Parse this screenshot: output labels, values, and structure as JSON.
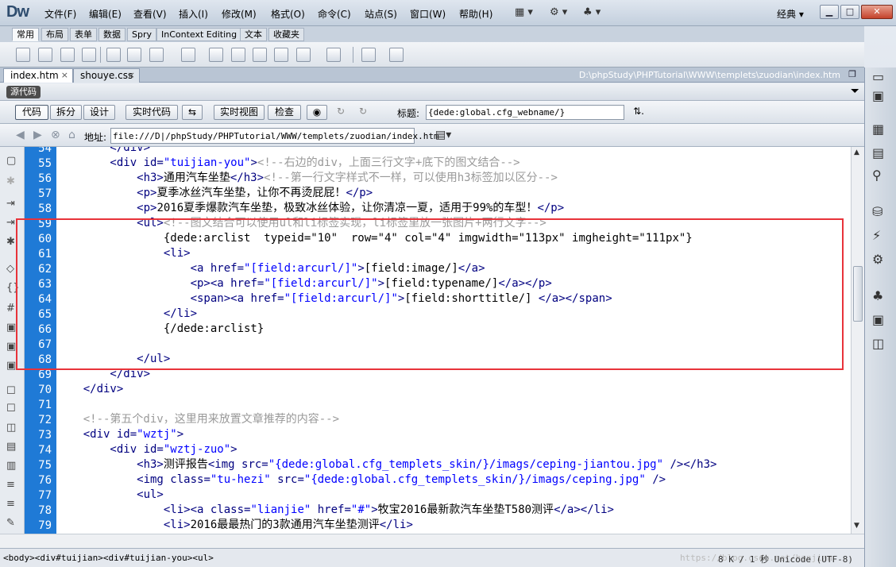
{
  "app": {
    "logo": "Dw",
    "layout": "经典",
    "win_min": "▁",
    "win_max": "□",
    "win_close": "✕"
  },
  "menu": [
    "文件(F)",
    "编辑(E)",
    "查看(V)",
    "插入(I)",
    "修改(M)",
    "格式(O)",
    "命令(C)",
    "站点(S)",
    "窗口(W)",
    "帮助(H)"
  ],
  "insert_tabs": [
    "常用",
    "布局",
    "表单",
    "数据",
    "Spry",
    "InContext Editing",
    "文本",
    "收藏夹"
  ],
  "doc_tabs": [
    {
      "label": "index.htm",
      "close": "×"
    },
    {
      "label": "shouye.css",
      "close": "×"
    }
  ],
  "file_path": "D:\\phpStudy\\PHPTutorial\\WWW\\templets\\zuodian\\index.htm",
  "source_label": "源代码",
  "view_buttons": {
    "code": "代码",
    "split": "拆分",
    "design": "设计",
    "live_code": "实时代码",
    "live_view": "实时视图",
    "inspect": "检查"
  },
  "title_label": "标题:",
  "title_value": "{dede:global.cfg_webname/}",
  "address_label": "地址:",
  "address_value": "file:///D|/phpStudy/PHPTutorial/WWW/templets/zuodian/index.htm",
  "line_numbers": [
    "54",
    "55",
    "56",
    "57",
    "58",
    "59",
    "60",
    "61",
    "62",
    "63",
    "64",
    "65",
    "66",
    "67",
    "68",
    "69",
    "70",
    "71",
    "72",
    "73",
    "74",
    "75",
    "76",
    "77",
    "78",
    "79"
  ],
  "code": {
    "l54": "        </div>",
    "l55_tag": "        <div ",
    "l55_attr": "id=",
    "l55_val": "\"tuijian-you\"",
    "l55_end": ">",
    "l55_cm": "<!--右边的div，上面三行文字+底下的图文结合-->",
    "l56_tag": "            <h3>",
    "l56_tx": "通用汽车坐垫",
    "l56_end": "</h3>",
    "l56_cm": "<!--第一行文字样式不一样，可以使用h3标签加以区分-->",
    "l57_tag": "            <p>",
    "l57_tx": "夏季冰丝汽车坐垫，让你不再烫屁屁！",
    "l57_end": "</p>",
    "l58_tag": "            <p>",
    "l58_tx": "2016夏季爆款汽车坐垫，极致冰丝体验，让你清凉一夏，适用于99%的车型！",
    "l58_end": "</p>",
    "l59_tag": "            <ul>",
    "l59_cm": "<!--图文结合可以使用ul和li标签实现，li标签里放一张图片+两行文字-->",
    "l60": "                {dede:arclist  typeid=\"10\"  row=\"4\" col=\"4\" imgwidth=\"113px\" imgheight=\"111px\"}",
    "l61": "                <li>",
    "l62_tag": "                    <a ",
    "l62_attr": "href=",
    "l62_val": "\"[field:arcurl/]\"",
    "l62_end": ">",
    "l62_tx": "[field:image/]",
    "l62_close": "</a>",
    "l63_tag": "                    <p><a ",
    "l63_attr": "href=",
    "l63_val": "\"[field:arcurl/]\"",
    "l63_end": ">",
    "l63_tx": "[field:typename/]",
    "l63_close": "</a></p>",
    "l64_tag": "                    <span><a ",
    "l64_attr": "href=",
    "l64_val": "\"[field:arcurl/]\"",
    "l64_end": ">",
    "l64_tx": "[field:shorttitle/] ",
    "l64_close": "</a></span>",
    "l65": "                </li>",
    "l66": "                {/dede:arclist}",
    "l67": "",
    "l68": "            </ul>",
    "l69": "        </div>",
    "l70": "    </div>",
    "l71": "",
    "l72": "    <!--第五个div，这里用来放置文章推荐的内容-->",
    "l73_tag": "    <div ",
    "l73_attr": "id=",
    "l73_val": "\"wztj\"",
    "l73_end": ">",
    "l74_tag": "        <div ",
    "l74_attr": "id=",
    "l74_val": "\"wztj-zuo\"",
    "l74_end": ">",
    "l75_tag": "            <h3>",
    "l75_tx": "测评报告",
    "l75_img": "<img ",
    "l75_attr": "src=",
    "l75_val": "\"{dede:global.cfg_templets_skin/}/imags/ceping-jiantou.jpg\"",
    "l75_end": " /></h3>",
    "l76_tag": "            <img ",
    "l76_attr1": "class=",
    "l76_val1": "\"tu-hezi\"",
    "l76_attr2": " src=",
    "l76_val2": "\"{dede:global.cfg_templets_skin/}/imags/ceping.jpg\"",
    "l76_end": " />",
    "l77": "            <ul>",
    "l78_tag": "                <li><a ",
    "l78_attr1": "class=",
    "l78_val1": "\"lianjie\"",
    "l78_attr2": " href=",
    "l78_val2": "\"#\"",
    "l78_end": ">",
    "l78_tx": "牧宝2016最新款汽车坐垫T580测评",
    "l78_close": "</a></li>",
    "l79_tag": "                <li>",
    "l79_tx": "2016最最热门的3款通用汽车坐垫测评",
    "l79_close": "</li>"
  },
  "status": {
    "tag_selector": "<body><div#tuijian><div#tuijian-you><ul>",
    "info": "8 K / 1 秒  Unicode (UTF-8)",
    "watermark": "https://blog.csdn.net/hanjian"
  }
}
